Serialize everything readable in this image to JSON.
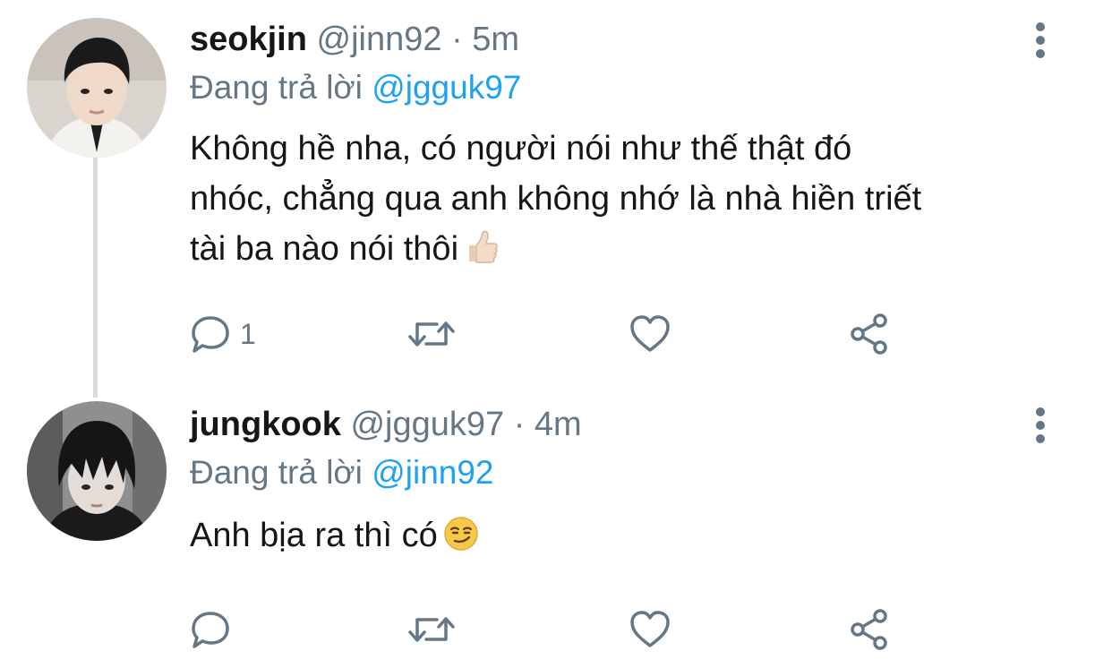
{
  "tweets": [
    {
      "display_name": "seokjin",
      "handle": "@jinn92",
      "separator": "·",
      "time": "5m",
      "reply_label": "Đang trả lời",
      "reply_to": "@jgguk97",
      "body_lines": [
        "Không hề nha, có người nói như thế thật đó",
        "nhóc, chẳng qua anh không nhớ là nhà hiền triết",
        "tài ba nào nói thôi"
      ],
      "emoji": "thumbs-up-light-skin-icon",
      "reply_count": "1"
    },
    {
      "display_name": "jungkook",
      "handle": "@jgguk97",
      "separator": "·",
      "time": "4m",
      "reply_label": "Đang trả lời",
      "reply_to": "@jinn92",
      "body_lines": [
        "Anh bịa ra thì có"
      ],
      "emoji": "smirking-face-icon",
      "reply_count": ""
    }
  ],
  "colors": {
    "text": "#14171a",
    "secondary": "#657786",
    "link": "#1da1f2",
    "thread_line": "#d6dbdf"
  }
}
